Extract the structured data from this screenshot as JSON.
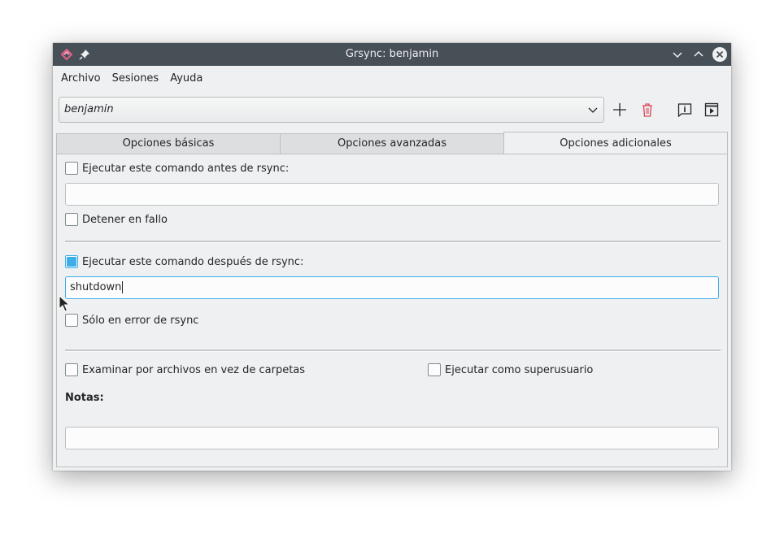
{
  "window": {
    "title": "Grsync: benjamin"
  },
  "menubar": {
    "items": [
      {
        "label": "Archivo"
      },
      {
        "label": "Sesiones"
      },
      {
        "label": "Ayuda"
      }
    ]
  },
  "session": {
    "selected": "benjamin"
  },
  "tabs": [
    {
      "label": "Opciones básicas"
    },
    {
      "label": "Opciones avanzadas"
    },
    {
      "label": "Opciones adicionales"
    }
  ],
  "panel": {
    "pre_command": {
      "label": "Ejecutar este comando antes de rsync:",
      "checked": false,
      "value": ""
    },
    "stop_on_fail": {
      "label": "Detener en fallo",
      "checked": false
    },
    "post_command": {
      "label": "Ejecutar este comando después de rsync:",
      "checked": true,
      "value": "shutdown"
    },
    "only_on_error": {
      "label": "Sólo en error de rsync",
      "checked": false
    },
    "browse_files": {
      "label": "Examinar por archivos en vez de carpetas",
      "checked": false
    },
    "run_as_superuser": {
      "label": "Ejecutar como superusuario",
      "checked": false
    },
    "notes": {
      "label": "Notas:",
      "value": ""
    }
  },
  "colors": {
    "titlebar": "#475057",
    "accent": "#3daee9",
    "delete": "#da4453",
    "window_bg": "#eff0f1"
  }
}
